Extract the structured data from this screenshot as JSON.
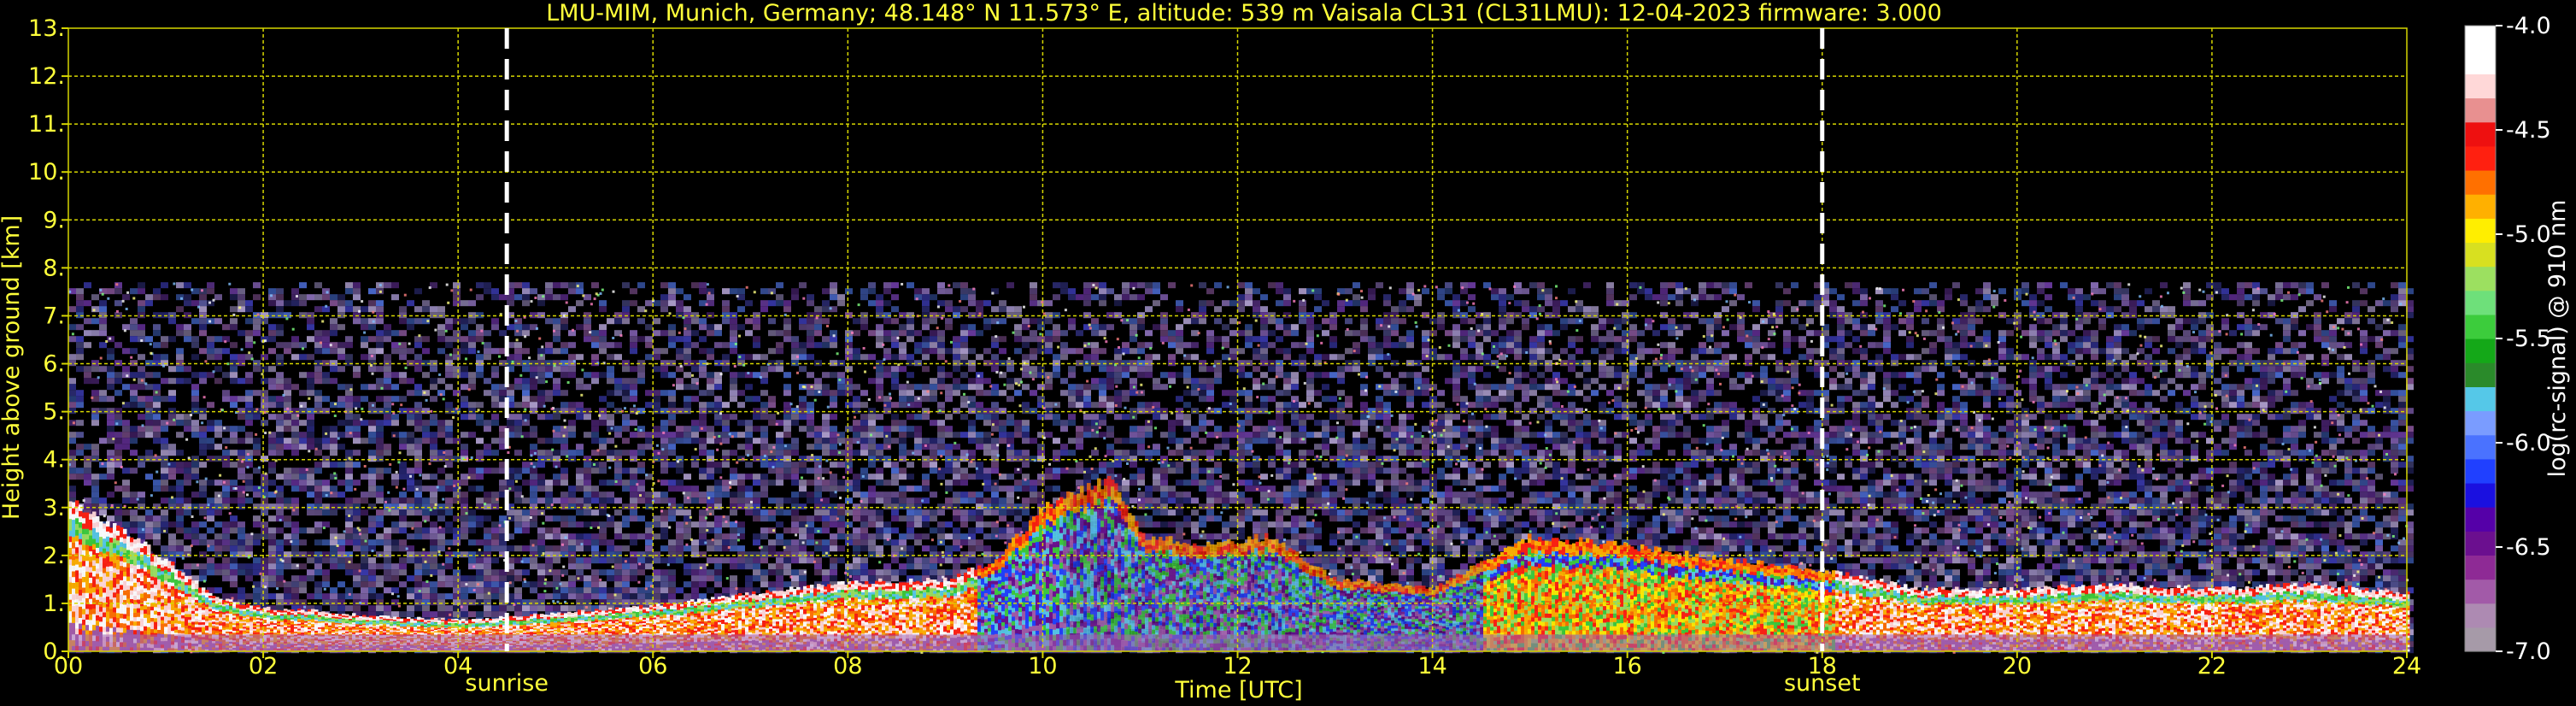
{
  "chart_data": {
    "type": "heatmap",
    "title": "LMU-MIM, Munich, Germany; 48.148° N 11.573° E, altitude: 539 m    Vaisala CL31 (CL31LMU): 12-04-2023    firmware: 3.000",
    "xlabel": "Time [UTC]",
    "ylabel": "Height above ground [km]",
    "xlim": [
      0,
      24
    ],
    "ylim": [
      0,
      13
    ],
    "x_ticks": [
      "00",
      "02",
      "04",
      "06",
      "08",
      "10",
      "12",
      "14",
      "16",
      "18",
      "20",
      "22",
      "24"
    ],
    "y_ticks": [
      "0.",
      "1.",
      "2.",
      "3.",
      "4.",
      "5.",
      "6.",
      "7.",
      "8.",
      "9.",
      "10.",
      "11.",
      "12.",
      "13."
    ],
    "grid": true,
    "noise_top_km": 7.7,
    "events": [
      {
        "label": "sunrise",
        "time": 4.5
      },
      {
        "label": "sunset",
        "time": 18.0
      }
    ],
    "boundary_layer_km": [
      [
        0,
        3.1
      ],
      [
        0.5,
        2.6
      ],
      [
        1,
        1.9
      ],
      [
        1.5,
        1.1
      ],
      [
        2,
        0.9
      ],
      [
        2.5,
        0.85
      ],
      [
        3,
        0.75
      ],
      [
        4,
        0.65
      ],
      [
        5,
        0.8
      ],
      [
        6,
        0.95
      ],
      [
        7,
        1.2
      ],
      [
        8,
        1.45
      ],
      [
        9,
        1.5
      ],
      [
        9.5,
        1.9
      ],
      [
        10,
        3.0
      ],
      [
        10.7,
        3.6
      ],
      [
        11,
        2.4
      ],
      [
        11.7,
        2.2
      ],
      [
        12.3,
        2.4
      ],
      [
        13,
        1.5
      ],
      [
        14,
        1.3
      ],
      [
        15,
        2.4
      ],
      [
        16,
        2.2
      ],
      [
        17,
        1.9
      ],
      [
        18,
        1.7
      ],
      [
        19,
        1.3
      ],
      [
        20,
        1.3
      ],
      [
        21,
        1.4
      ],
      [
        22,
        1.3
      ],
      [
        23,
        1.4
      ],
      [
        24,
        1.2
      ]
    ],
    "colorbar": {
      "label": "log(rc-signal) @ 910 nm",
      "range": [
        -7.0,
        -4.0
      ],
      "ticks": [
        "-4.0",
        "-4.5",
        "-5.0",
        "-5.5",
        "-6.0",
        "-6.5",
        "-7.0"
      ],
      "colors": [
        "#a69aa8",
        "#ad8ab2",
        "#a25aa8",
        "#8e2a95",
        "#6b0f8f",
        "#5500a8",
        "#1a10e0",
        "#2040ff",
        "#4a72ff",
        "#7a9cff",
        "#55c8e8",
        "#2a8a2a",
        "#14a818",
        "#3ccc3c",
        "#6ee07a",
        "#9ce060",
        "#d8e020",
        "#ffee00",
        "#ffb000",
        "#ff7000",
        "#ff2010",
        "#ee1010",
        "#e89090",
        "#ffd8d8",
        "#ffffff",
        "#ffffff"
      ]
    }
  }
}
